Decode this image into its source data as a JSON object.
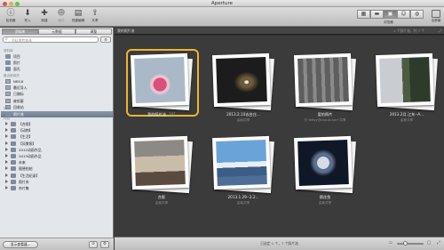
{
  "window": {
    "title": "Aperture"
  },
  "toolbar": {
    "buttons": [
      {
        "label": "检查器",
        "icon": "info-icon",
        "glyph": "ⓘ",
        "enabled": true
      },
      {
        "label": "导入",
        "icon": "import-icon",
        "glyph": "⬇",
        "enabled": true
      },
      {
        "label": "新建",
        "icon": "new-icon",
        "glyph": "✚",
        "enabled": true
      },
      {
        "label": "面孔",
        "icon": "faces-icon",
        "glyph": "☻",
        "enabled": false
      },
      {
        "label": "快捷编辑",
        "icon": "quick-edit-icon",
        "glyph": "▤",
        "enabled": true
      },
      {
        "label": "共享",
        "icon": "share-icon",
        "glyph": "⇪",
        "enabled": true
      }
    ],
    "view_label": "浏览器",
    "fullscreen_label": "全屏幕"
  },
  "sidebar": {
    "tabs": [
      {
        "label": "资料库",
        "active": true
      },
      {
        "label": "元数据",
        "active": false
      },
      {
        "label": "调整",
        "active": false
      }
    ],
    "search_placeholder": "资料库检查器",
    "sections": [
      {
        "head": "资料库",
        "items": [
          {
            "label": "项目"
          },
          {
            "label": "照片"
          },
          {
            "label": "面孔"
          }
        ]
      },
      {
        "head": "最近使用的",
        "items": [
          {
            "label": "NEK-8"
          },
          {
            "label": "最近导入"
          },
          {
            "label": "已旗标"
          },
          {
            "label": "废纸篓"
          },
          {
            "label": "回收站"
          }
        ]
      },
      {
        "head": "WEB",
        "items": [
          {
            "label": "照片流",
            "selected": true
          }
        ]
      },
      {
        "head": "项目",
        "items": [
          {
            "label": "【合照】"
          },
          {
            "label": "【动物】"
          },
          {
            "label": "【生活】"
          },
          {
            "label": "【风景照】"
          },
          {
            "label": "2012动画作品"
          },
          {
            "label": "2013动画作品"
          },
          {
            "label": "未来"
          },
          {
            "label": "随便拍拍"
          },
          {
            "label": "【生活纪录】"
          },
          {
            "label": "照片夹"
          },
          {
            "label": "杂片集"
          }
        ]
      }
    ],
    "import_button": "显示查看器..."
  },
  "browser": {
    "header_title": "我的照片流",
    "header_count": "1 个照片流，共 7 个",
    "albums": [
      {
        "title": "我的照片流",
        "count": "161",
        "subtitle": "",
        "selected": true,
        "pic": "p1"
      },
      {
        "title": "2013.2.10去台庄...",
        "subtitle": "由我共享",
        "pic": "p2"
      },
      {
        "title": "爱拍照片",
        "subtitle": "与\"leftyy@icloud.com\"共享",
        "pic": "p3"
      },
      {
        "title": "2013.2月.江东--A...",
        "subtitle": "由我共享",
        "pic": "p4"
      },
      {
        "title": "合影",
        "subtitle": "由我共享",
        "pic": "p5"
      },
      {
        "title": "2013.1.29--2.2...",
        "subtitle": "由我共享",
        "pic": "p6"
      },
      {
        "title": "猜花鱼",
        "subtitle": "由我共享",
        "pic": "p7"
      }
    ],
    "footer_text": "已选定 1 个，7 个照片流"
  }
}
